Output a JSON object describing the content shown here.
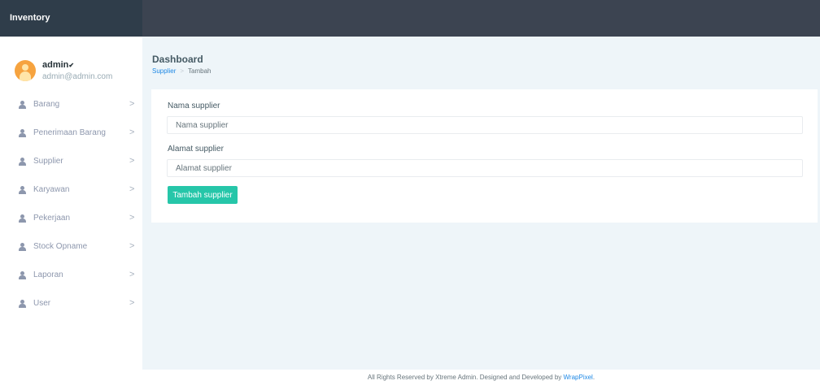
{
  "app": {
    "brand": "Inventory"
  },
  "user": {
    "name": "admin",
    "caret": "✔",
    "email": "admin@admin.com"
  },
  "sidebar": {
    "items": [
      {
        "label": "Barang"
      },
      {
        "label": "Penerimaan Barang"
      },
      {
        "label": "Supplier"
      },
      {
        "label": "Karyawan"
      },
      {
        "label": "Pekerjaan"
      },
      {
        "label": "Stock Opname"
      },
      {
        "label": "Laporan"
      },
      {
        "label": "User"
      }
    ],
    "chevron": ">"
  },
  "page": {
    "title": "Dashboard"
  },
  "breadcrumb": {
    "items": [
      "Supplier",
      "Tambah"
    ],
    "separator": ">"
  },
  "form": {
    "nama_label": "Nama supplier",
    "nama_placeholder": "Nama supplier",
    "alamat_label": "Alamat supplier",
    "alamat_placeholder": "Alamat supplier",
    "submit_label": "Tambah supplier"
  },
  "footer": {
    "text": "All Rights Reserved by Xtreme Admin. Designed and Developed by",
    "link": "WrapPixel",
    "end": "."
  },
  "colors": {
    "topbar": "#3c4451",
    "accent": "#26c6a9",
    "link": "#1e88e5",
    "avatar": "#f6a33f"
  }
}
